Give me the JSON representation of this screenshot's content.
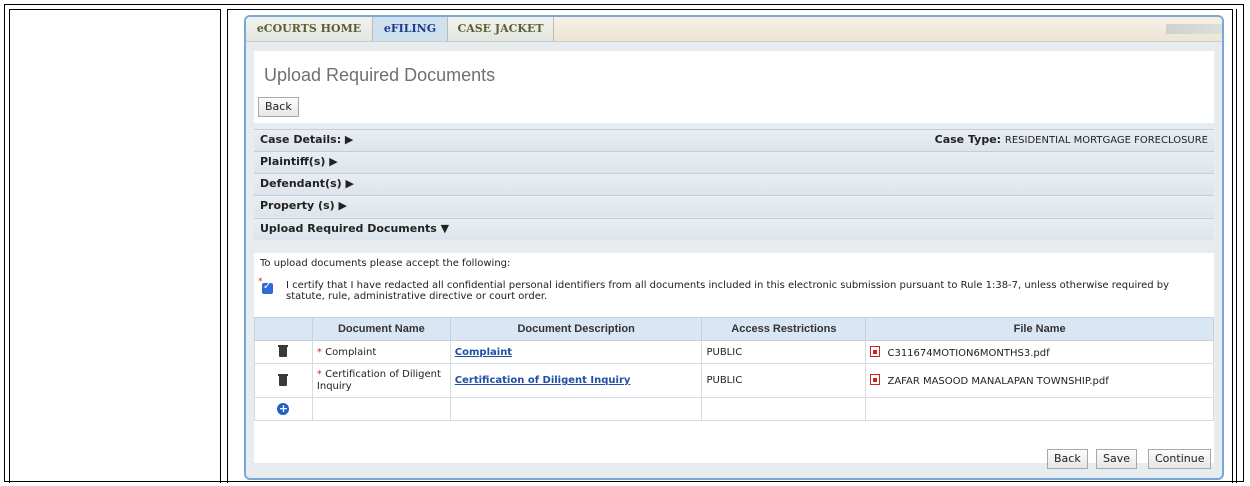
{
  "nav": {
    "tabs": [
      {
        "label": "eCOURTS HOME"
      },
      {
        "label": "eFILING"
      },
      {
        "label": "CASE JACKET"
      }
    ]
  },
  "page_title": "Upload Required Documents",
  "back_top_label": "Back",
  "sections": {
    "case_details": "Case Details: ▶",
    "case_type_label": "Case Type:",
    "case_type_value": "RESIDENTIAL MORTGAGE FORECLOSURE",
    "plaintiffs": "Plaintiff(s) ▶",
    "defendants": "Defendant(s) ▶",
    "property": "Property (s) ▶",
    "upload": "Upload Required Documents ▼"
  },
  "upload": {
    "instruction": "To upload documents please accept the following:",
    "required_marker": "*",
    "certify_checked": true,
    "certify_text": "I certify that I have redacted all confidential personal identifiers from all documents included in this electronic submission pursuant to Rule 1:38-7, unless otherwise required by statute, rule, administrative directive or court order."
  },
  "table": {
    "headers": [
      "Document Name",
      "Document Description",
      "Access Restrictions",
      "File Name"
    ],
    "rows": [
      {
        "name": "Complaint",
        "description": "Complaint",
        "access": "PUBLIC",
        "file": "C311674MOTION6MONTHS3.pdf"
      },
      {
        "name": "Certification of Diligent Inquiry",
        "description": "Certification of Diligent Inquiry",
        "access": "PUBLIC",
        "file": "ZAFAR MASOOD MANALAPAN TOWNSHIP.pdf"
      }
    ]
  },
  "footer": {
    "back_label": "Back",
    "save_label": "Save",
    "continue_label": "Continue"
  },
  "icons": {
    "delete": "trash-icon",
    "add": "add-row-icon",
    "file": "pdf-icon"
  }
}
